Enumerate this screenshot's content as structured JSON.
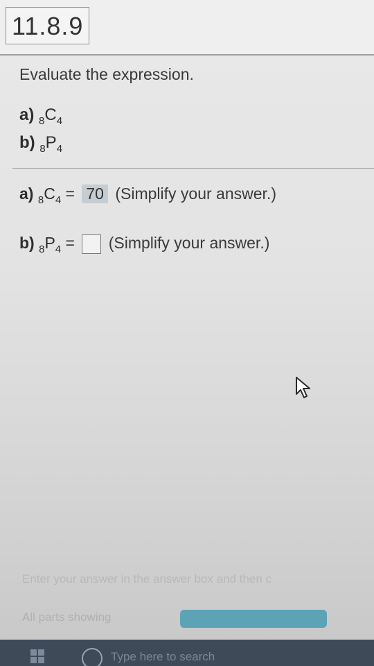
{
  "problem": {
    "number": "11.8.9",
    "instruction": "Evaluate the expression.",
    "parts": [
      {
        "label": "a)",
        "pre": "8",
        "letter": "C",
        "post": "4"
      },
      {
        "label": "b)",
        "pre": "8",
        "letter": "P",
        "post": "4"
      }
    ],
    "answers": [
      {
        "label": "a)",
        "pre": "8",
        "letter": "C",
        "post": "4",
        "equals": "=",
        "value": "70",
        "hint": "(Simplify your answer.)"
      },
      {
        "label": "b)",
        "pre": "8",
        "letter": "P",
        "post": "4",
        "equals": "=",
        "value": "",
        "hint": "(Simplify your answer.)"
      }
    ]
  },
  "footer": {
    "instruction_text": "Enter your answer in the answer box and then c",
    "parts_showing": "All parts showing",
    "progress_fraction": 1.0
  },
  "taskbar": {
    "search_placeholder": "Type here to search",
    "start_icon": "windows-logo-icon",
    "search_icon": "cortana-circle-icon"
  },
  "colors": {
    "answer_highlight": "#c5ccd2",
    "progress": "#5da3b6",
    "taskbar": "#3f4a58"
  }
}
